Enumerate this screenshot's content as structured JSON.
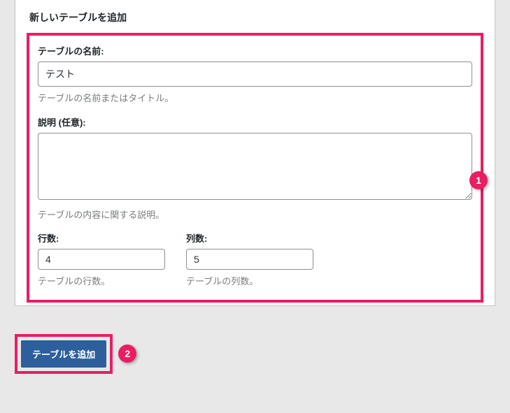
{
  "panel": {
    "title": "新しいテーブルを追加"
  },
  "fields": {
    "name": {
      "label": "テーブルの名前:",
      "value": "テスト",
      "help": "テーブルの名前またはタイトル。"
    },
    "description": {
      "label": "説明 (任意):",
      "value": "",
      "help": "テーブルの内容に関する説明。"
    },
    "rows": {
      "label": "行数:",
      "value": "4",
      "help": "テーブルの行数。"
    },
    "cols": {
      "label": "列数:",
      "value": "5",
      "help": "テーブルの列数。"
    }
  },
  "buttons": {
    "submit": "テーブルを追加"
  },
  "annotations": {
    "badge1": "1",
    "badge2": "2"
  }
}
